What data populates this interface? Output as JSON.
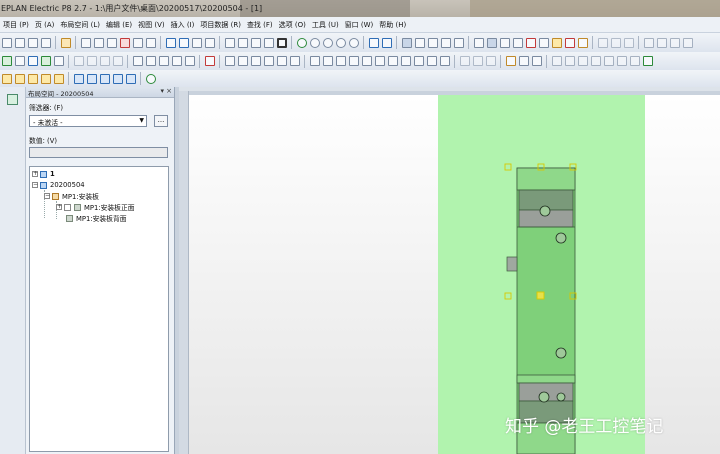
{
  "window": {
    "title": "EPLAN Electric P8 2.7 - 1:\\用户文件\\桌面\\20200517\\20200504 - [1]"
  },
  "menu": [
    "项目 (P)",
    "页 (A)",
    "布局空间 (L)",
    "编辑 (E)",
    "视图 (V)",
    "插入 (I)",
    "项目数据 (R)",
    "查找 (F)",
    "选项 (O)",
    "工具 (U)",
    "窗口 (W)",
    "帮助 (H)"
  ],
  "panel": {
    "title": "布局空间 - 20200504",
    "pin": "▾",
    "close": "×",
    "filter_label": "筛选器: (F)",
    "filter_value": "- 未激活 -",
    "filter_button": "...",
    "value_label": "数值: (V)",
    "value_input": ""
  },
  "tree": {
    "node_1": "1",
    "node_project": "20200504",
    "node_mp1": "MP1:安装板",
    "node_front": "MP1:安装板正面",
    "node_back": "MP1:安装板背面",
    "expander_plus": "+",
    "expander_minus": "−"
  },
  "watermark": "知乎 @老王工控笔记",
  "colors": {
    "layout_green": "#b1f3ae",
    "plate_green": "#7fd07a",
    "handle_yellow": "#e8e04a"
  }
}
